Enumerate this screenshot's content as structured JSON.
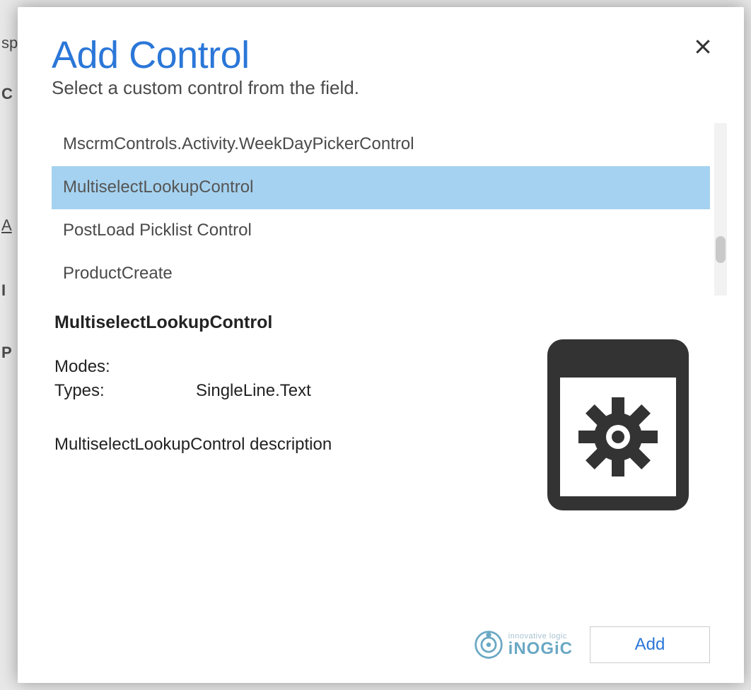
{
  "background": {
    "sp": "sp",
    "c": "C",
    "a": "A",
    "i": "I",
    "p": "P"
  },
  "modal": {
    "title": "Add Control",
    "subtitle": "Select a custom control from the field.",
    "close_label": "Close",
    "list": [
      {
        "label": "MscrmControls.Activity.WeekDayPickerControl",
        "selected": false
      },
      {
        "label": "MultiselectLookupControl",
        "selected": true
      },
      {
        "label": "PostLoad Picklist Control",
        "selected": false
      },
      {
        "label": "ProductCreate",
        "selected": false
      }
    ],
    "selected_name": "MultiselectLookupControl",
    "modes_label": "Modes:",
    "modes_value": "",
    "types_label": "Types:",
    "types_value": "SingleLine.Text",
    "description": "MultiselectLookupControl description",
    "add_label": "Add"
  },
  "brand": {
    "tagline": "innovative logic",
    "name": "iNOGiC"
  },
  "colors": {
    "accent": "#2b77d8",
    "selection": "#a5d2f0"
  }
}
